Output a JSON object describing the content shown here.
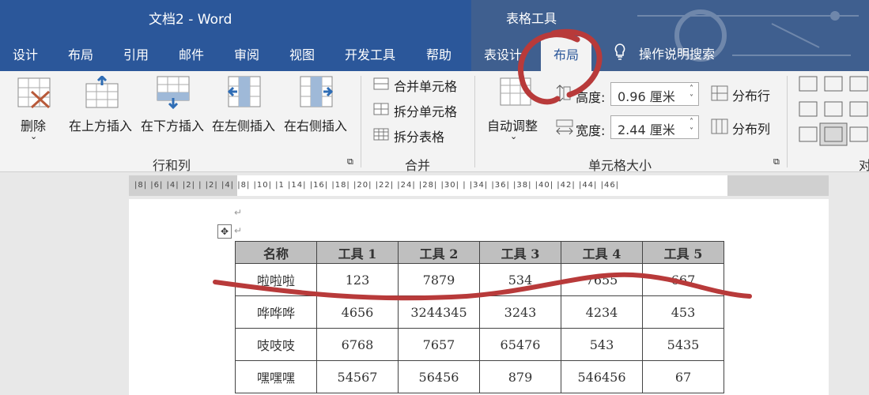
{
  "title": "文档2  -  Word",
  "context_label": "表格工具",
  "tabs": [
    "设计",
    "布局",
    "引用",
    "邮件",
    "审阅",
    "视图",
    "开发工具",
    "帮助",
    "表设计"
  ],
  "active_tab": "布局",
  "tell_me": "操作说明搜索",
  "ribbon": {
    "delete": "删除",
    "insert_above": "在上方插入",
    "insert_below": "在下方插入",
    "insert_left": "在左侧插入",
    "insert_right": "在右侧插入",
    "group_rows_cols": "行和列",
    "merge_cells": "合并单元格",
    "split_cells": "拆分单元格",
    "split_table": "拆分表格",
    "group_merge": "合并",
    "autofit": "自动调整",
    "height_label": "高度:",
    "height_value": "0.96 厘米",
    "width_label": "宽度:",
    "width_value": "2.44 厘米",
    "distribute_rows": "分布行",
    "distribute_cols": "分布列",
    "group_cell_size": "单元格大小",
    "group_align": "对"
  },
  "ruler_text": "|8|  |6|  |4|  |2|        |  |2|  |4|        |8|  |10|  |1  |14|  |16|  |18|  |20|  |22|  |24|       |28|  |30|  |  |34|  |36|  |38|  |40|  |42|  |44|  |46|",
  "table": {
    "headers": [
      "名称",
      "工具 1",
      "工具 2",
      "工具 3",
      "工具 4",
      "工具 5"
    ],
    "rows": [
      [
        "啦啦啦",
        "123",
        "7879",
        "534",
        "7655",
        "667"
      ],
      [
        "哗哗哗",
        "4656",
        "3244345",
        "3243",
        "4234",
        "453"
      ],
      [
        "吱吱吱",
        "6768",
        "7657",
        "65476",
        "543",
        "5435"
      ],
      [
        "嘿嘿嘿",
        "54567",
        "56456",
        "879",
        "546456",
        "67"
      ]
    ]
  },
  "colors": {
    "titlebar": "#2b579a",
    "annotation": "#b83a3a"
  }
}
